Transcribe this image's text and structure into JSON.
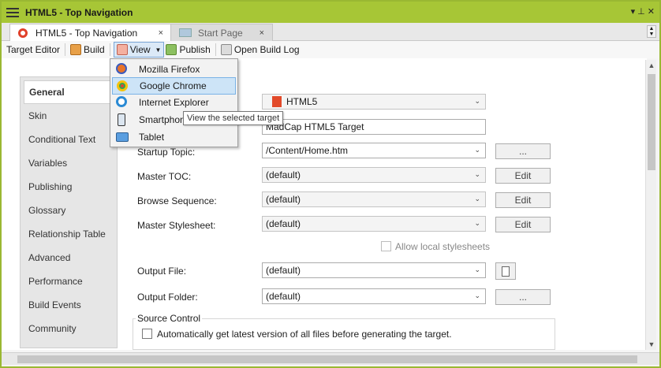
{
  "window": {
    "title": "HTML5 - Top Navigation",
    "pin_symbol": "▾  ⊥  ✕"
  },
  "tabs": [
    {
      "label": "HTML5 - Top Navigation",
      "close": "×"
    },
    {
      "label": "Start Page",
      "close": "×"
    }
  ],
  "toolbar": {
    "target_editor": "Target Editor",
    "build": "Build",
    "view": "View",
    "publish": "Publish",
    "open_build_log": "Open Build Log"
  },
  "view_menu": {
    "items": [
      "Mozilla Firefox",
      "Google Chrome",
      "Internet Explorer",
      "Smartphone",
      "Tablet"
    ],
    "highlighted": "Google Chrome",
    "tooltip": "View the selected target"
  },
  "sidebar": {
    "items": [
      "General",
      "Skin",
      "Conditional Text",
      "Variables",
      "Publishing",
      "Glossary",
      "Relationship Table",
      "Advanced",
      "Performance",
      "Build Events",
      "Community"
    ],
    "active": "General"
  },
  "general": {
    "output_type_value": "HTML5",
    "description_value": "MadCap HTML5 Target",
    "startup_topic_label": "Startup Topic:",
    "startup_topic_value": "/Content/Home.htm",
    "master_toc_label": "Master TOC:",
    "master_toc_value": "(default)",
    "browse_sequence_label": "Browse Sequence:",
    "browse_sequence_value": "(default)",
    "master_stylesheet_label": "Master Stylesheet:",
    "master_stylesheet_value": "(default)",
    "allow_local_stylesheets": "Allow local stylesheets",
    "output_file_label": "Output File:",
    "output_file_value": "(default)",
    "output_folder_label": "Output Folder:",
    "output_folder_value": "(default)",
    "browse_button": "...",
    "edit_button": "Edit",
    "source_control_label": "Source Control",
    "source_control_checkbox": "Automatically get latest version of all files before generating the target."
  }
}
